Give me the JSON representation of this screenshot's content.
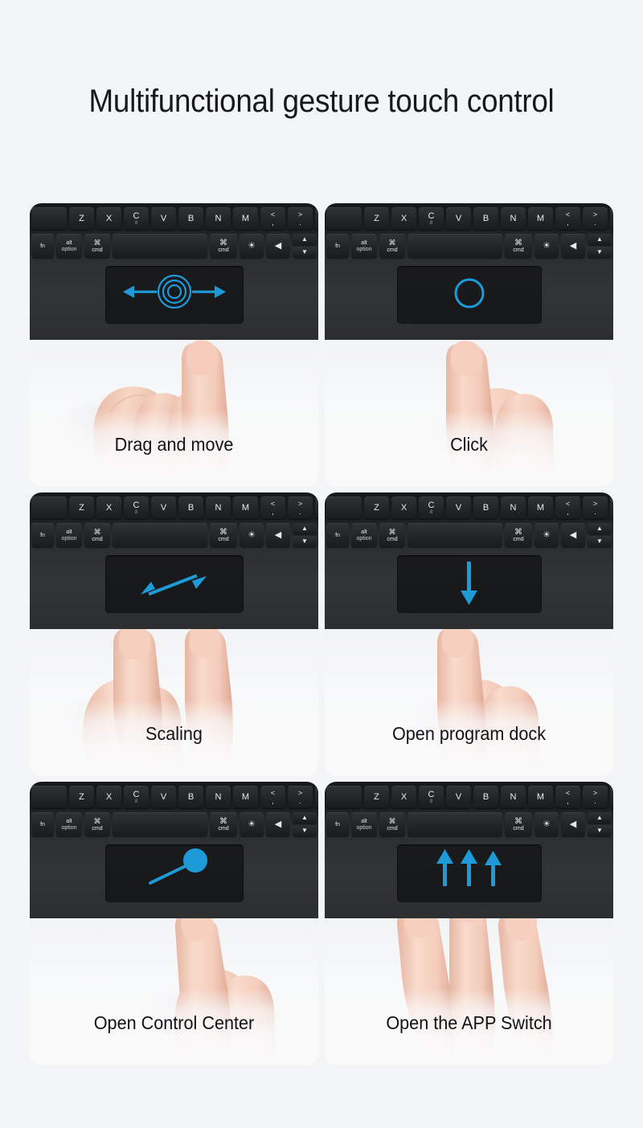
{
  "page": {
    "title": "Multifunctional gesture touch control",
    "background_color": "#f4f5f7",
    "accent_color": "#1e9ad8"
  },
  "keyboard": {
    "top_row": [
      {
        "label": "Z",
        "sub": ""
      },
      {
        "label": "X",
        "sub": ""
      },
      {
        "label": "C",
        "sub": "8"
      },
      {
        "label": "V",
        "sub": ""
      },
      {
        "label": "B",
        "sub": ""
      },
      {
        "label": "N",
        "sub": ""
      },
      {
        "label": "M",
        "sub": ""
      },
      {
        "label": "<",
        "sub": ","
      },
      {
        "label": ">",
        "sub": "."
      },
      {
        "label": "?",
        "sub": "/"
      }
    ],
    "bottom_row": [
      {
        "name": "fn-key",
        "label": "fn",
        "sub": ""
      },
      {
        "name": "alt-option-key",
        "label": "alt",
        "sub": "option"
      },
      {
        "name": "command-left-key",
        "label": "⌘",
        "sub": "cmd"
      },
      {
        "name": "space-key",
        "label": "",
        "sub": ""
      },
      {
        "name": "command-right-key",
        "label": "⌘",
        "sub": "cmd"
      },
      {
        "name": "brightness-key",
        "label": "☀",
        "sub": ""
      },
      {
        "name": "left-arrow-key",
        "label": "◀",
        "sub": ""
      },
      {
        "name": "updown-arrow-key",
        "label": "▲",
        "sub": "▼"
      }
    ]
  },
  "panels": [
    {
      "id": "drag-and-move",
      "caption": "Drag and move",
      "gesture": "one-finger-drag-horizontal",
      "fingers": 1,
      "arrows": [
        "left",
        "right"
      ],
      "marker": "concentric-circles"
    },
    {
      "id": "click",
      "caption": "Click",
      "gesture": "one-finger-tap",
      "fingers": 1,
      "arrows": [],
      "marker": "single-circle"
    },
    {
      "id": "scaling",
      "caption": "Scaling",
      "gesture": "two-finger-pinch",
      "fingers": 2,
      "arrows": [
        "diagonal-double"
      ],
      "marker": "none"
    },
    {
      "id": "open-program-dock",
      "caption": "Open program dock",
      "gesture": "one-finger-swipe-down",
      "fingers": 1,
      "arrows": [
        "down"
      ],
      "marker": "none"
    },
    {
      "id": "open-control-center",
      "caption": "Open Control Center",
      "gesture": "one-finger-swipe-from-corner",
      "fingers": 1,
      "arrows": [
        "diagonal-blob"
      ],
      "marker": "filled-blob"
    },
    {
      "id": "open-the-app-switch",
      "caption": "Open the APP Switch",
      "gesture": "three-finger-swipe-up",
      "fingers": 3,
      "arrows": [
        "up",
        "up",
        "up"
      ],
      "marker": "none"
    }
  ]
}
